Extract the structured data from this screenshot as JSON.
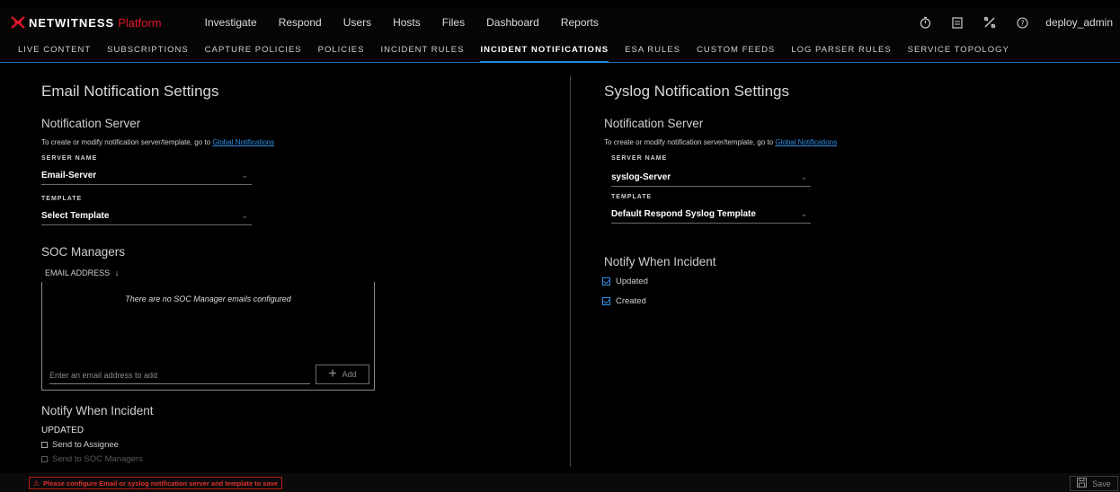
{
  "app": {
    "brand": "NETWITNESS",
    "platform": "Platform"
  },
  "topnav": [
    "Investigate",
    "Respond",
    "Users",
    "Hosts",
    "Files",
    "Dashboard",
    "Reports"
  ],
  "top_icons": [
    "stopwatch-icon",
    "notes-icon",
    "tools-icon",
    "help-icon"
  ],
  "user": "deploy_admin",
  "subnav": {
    "items": [
      "LIVE CONTENT",
      "SUBSCRIPTIONS",
      "CAPTURE POLICIES",
      "POLICIES",
      "INCIDENT RULES",
      "INCIDENT NOTIFICATIONS",
      "ESA RULES",
      "CUSTOM FEEDS",
      "LOG PARSER RULES",
      "SERVICE TOPOLOGY"
    ],
    "active": "INCIDENT NOTIFICATIONS"
  },
  "email": {
    "title": "Email Notification Settings",
    "server_heading": "Notification Server",
    "hint": "To create or modify notification server/template, go to",
    "hint_link": "Global Notifications",
    "server_label": "SERVER NAME",
    "server_value": "Email-Server",
    "template_label": "TEMPLATE",
    "template_value": "Select Template",
    "soc_heading": "SOC Managers",
    "email_col": "EMAIL ADDRESS",
    "empty_msg": "There are no SOC Manager emails configured",
    "email_placeholder": "Enter an email address to add",
    "add_label": "Add",
    "notify_heading": "Notify When Incident",
    "updated_label": "UPDATED",
    "opt_assignee": "Send to Assignee",
    "opt_soc": "Send to SOC Managers"
  },
  "syslog": {
    "title": "Syslog Notification Settings",
    "server_heading": "Notification Server",
    "hint": "To create or modify notification server/template, go to",
    "hint_link": "Global Notifications",
    "server_label": "SERVER NAME",
    "server_value": "syslog-Server",
    "template_label": "TEMPLATE",
    "template_value": "Default Respond Syslog Template",
    "notify_heading": "Notify When Incident",
    "opt_updated": "Updated",
    "opt_created": "Created"
  },
  "footer": {
    "warning": "Please configure Email or syslog notification server and template to save",
    "save_label": "Save"
  },
  "colors": {
    "accent": "#1f8ad8",
    "brand_red": "#e2162a",
    "warning": "#e03131",
    "link": "#2e8ee6"
  }
}
